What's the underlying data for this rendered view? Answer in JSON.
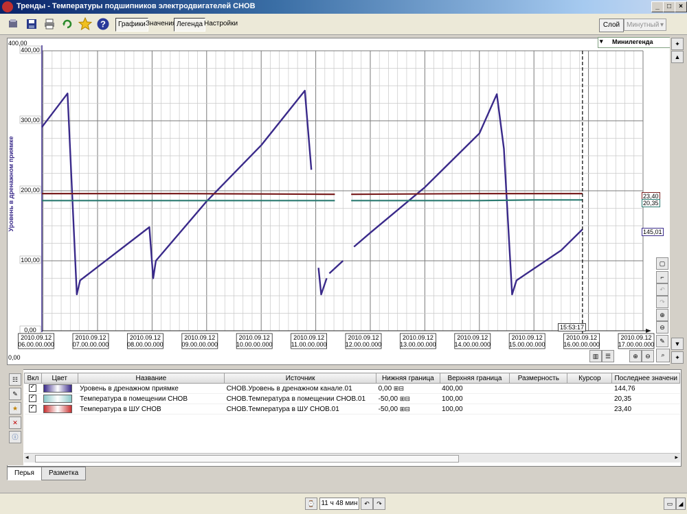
{
  "window": {
    "title": "Тренды - Температуры подшипников электродвигателей СНОВ"
  },
  "toolbar": {
    "tabs": [
      "Графики",
      "Значения",
      "Легенда",
      "Настройки"
    ],
    "layer_label": "Слой",
    "interval_value": "Минутный"
  },
  "chart": {
    "minilegend_label": "Минилегенда",
    "axis_top_label": "400,00",
    "axis_bottom_label": "0,00",
    "cursor_time": "15:53:17",
    "right_labels": [
      "23,40",
      "20,35",
      "145,01"
    ]
  },
  "chart_data": {
    "type": "line",
    "ylabel": "Уровень в дренажном приямке",
    "ylim": [
      0,
      400
    ],
    "y_ticks": [
      "400,00",
      "300,00",
      "200,00",
      "100,00",
      "0,00"
    ],
    "x_ticks": [
      {
        "date": "2010.09.12",
        "time": "06.00.00.000"
      },
      {
        "date": "2010.09.12",
        "time": "07.00.00.000"
      },
      {
        "date": "2010.09.12",
        "time": "08.00.00.000"
      },
      {
        "date": "2010.09.12",
        "time": "09.00.00.000"
      },
      {
        "date": "2010.09.12",
        "time": "10.00.00.000"
      },
      {
        "date": "2010.09.12",
        "time": "11.00.00.000"
      },
      {
        "date": "2010.09.12",
        "time": "12.00.00.000"
      },
      {
        "date": "2010.09.12",
        "time": "13.00.00.000"
      },
      {
        "date": "2010.09.12",
        "time": "14.00.00.000"
      },
      {
        "date": "2010.09.12",
        "time": "15.00.00.000"
      },
      {
        "date": "2010.09.12",
        "time": "16.00.00.000"
      },
      {
        "date": "2010.09.12",
        "time": "17.00.00.000"
      }
    ],
    "x_hours_range": [
      5.98,
      17.0
    ],
    "cursor_hour": 15.89,
    "series": [
      {
        "color": "#3a2a8a",
        "segments": [
          [
            [
              5.98,
              291
            ],
            [
              6.45,
              339
            ],
            [
              6.62,
              52
            ],
            [
              6.68,
              72
            ],
            [
              7.95,
              148
            ],
            [
              8.02,
              75
            ],
            [
              8.07,
              100
            ],
            [
              9.0,
              185
            ],
            [
              10.0,
              265
            ],
            [
              10.8,
              343
            ],
            [
              10.92,
              230
            ]
          ],
          [
            [
              11.05,
              90
            ],
            [
              11.1,
              52
            ],
            [
              11.2,
              75
            ]
          ],
          [
            [
              11.25,
              82
            ],
            [
              11.5,
              100
            ]
          ],
          [
            [
              11.7,
              120
            ],
            [
              12.0,
              140
            ],
            [
              13.0,
              205
            ],
            [
              14.0,
              282
            ],
            [
              14.32,
              338
            ],
            [
              14.45,
              260
            ],
            [
              14.6,
              52
            ],
            [
              14.68,
              72
            ],
            [
              15.5,
              115
            ],
            [
              15.89,
              145
            ]
          ]
        ]
      },
      {
        "color": "#7a2020",
        "segments": [
          [
            [
              5.98,
              196
            ],
            [
              8.5,
              196
            ],
            [
              11.35,
              195
            ]
          ],
          [
            [
              11.65,
              195
            ],
            [
              14.0,
              196
            ],
            [
              15.89,
              196
            ]
          ]
        ]
      },
      {
        "color": "#2a7a70",
        "segments": [
          [
            [
              5.98,
              186
            ],
            [
              8.5,
              186
            ],
            [
              11.35,
              186
            ]
          ],
          [
            [
              11.65,
              186
            ],
            [
              14.0,
              186
            ],
            [
              15.0,
              187
            ],
            [
              15.89,
              187
            ]
          ]
        ]
      }
    ]
  },
  "legend_table": {
    "headers": [
      "Вкл",
      "Цвет",
      "Название",
      "Источник",
      "Нижняя граница",
      "Верхняя граница",
      "Размерность",
      "Курсор",
      "Последнее значени"
    ],
    "rows": [
      {
        "name": "Уровень в дренажном приямке",
        "source": "СНОВ.Уровень в дренажном канале.01",
        "low": "0,00",
        "high": "400,00",
        "unit": "",
        "cursor": "",
        "last": "144,76",
        "color": "#3a2a8a"
      },
      {
        "name": "Температура в помещении СНОВ",
        "source": "СНОВ.Температура в помещении СНОВ.01",
        "low": "-50,00",
        "high": "100,00",
        "unit": "",
        "cursor": "",
        "last": "20,35",
        "color": "#8ac8c8"
      },
      {
        "name": "Температура в ШУ СНОВ",
        "source": "СНОВ.Температура в ШУ СНОВ.01",
        "low": "-50,00",
        "high": "100,00",
        "unit": "",
        "cursor": "",
        "last": "23,40",
        "color": "#c83030"
      }
    ]
  },
  "bottom_tabs": [
    "Перья",
    "Разметка"
  ],
  "status": {
    "elapsed": "11 ч 48 мин"
  }
}
